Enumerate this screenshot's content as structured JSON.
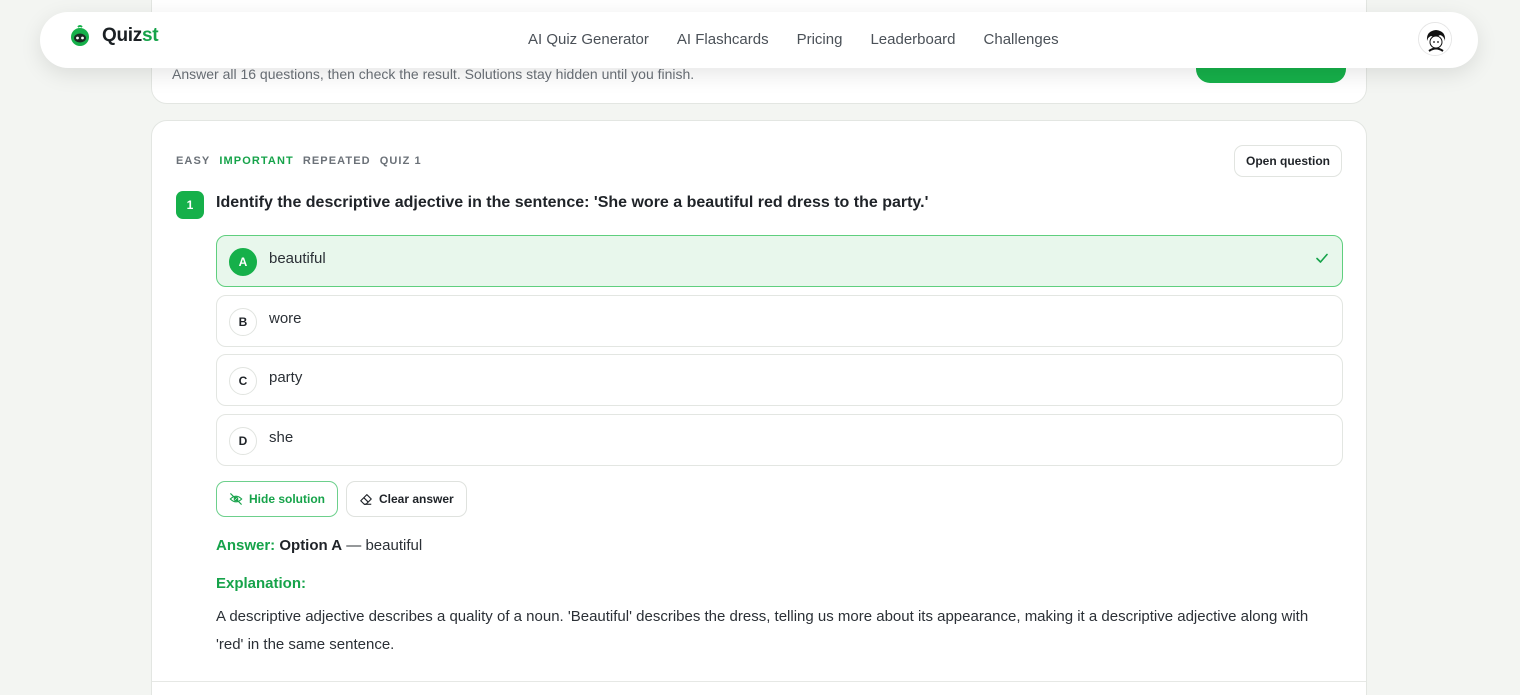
{
  "summary": {
    "text": "Answer all 16 questions, then check the result. Solutions stay hidden until you finish."
  },
  "nav": {
    "brand_part1": "Quiz",
    "brand_part2": "st",
    "links": [
      "AI Quiz Generator",
      "AI Flashcards",
      "Pricing",
      "Leaderboard",
      "Challenges"
    ]
  },
  "question": {
    "tags": [
      "EASY",
      "IMPORTANT",
      "REPEATED",
      "QUIZ 1"
    ],
    "open_label": "Open question",
    "number": "1",
    "text": "Identify the descriptive adjective in the sentence: 'She wore a beautiful red dress to the party.'",
    "options": [
      {
        "letter": "A",
        "text": "beautiful",
        "selected": true
      },
      {
        "letter": "B",
        "text": "wore",
        "selected": false
      },
      {
        "letter": "C",
        "text": "party",
        "selected": false
      },
      {
        "letter": "D",
        "text": "she",
        "selected": false
      }
    ],
    "hide_solution_label": "Hide solution",
    "clear_answer_label": "Clear answer",
    "answer_label": "Answer:",
    "answer_option": "Option A",
    "answer_text": "— beautiful",
    "explanation_label": "Explanation:",
    "explanation_text": "A descriptive adjective describes a quality of a noun. 'Beautiful' describes the dress, telling us more about its appearance, making it a descriptive adjective along with 'red' in the same sentence."
  },
  "colors": {
    "accent": "#16b04a",
    "accent_text": "#16a34a",
    "selected_bg": "#e8f7ec"
  }
}
